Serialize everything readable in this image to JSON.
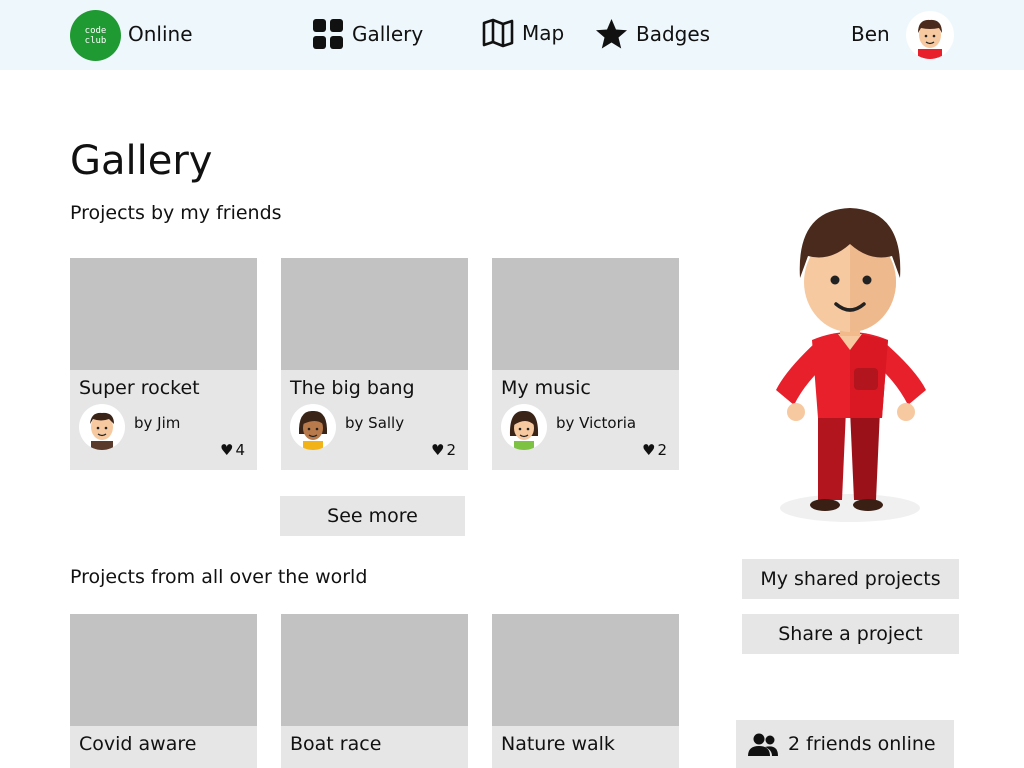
{
  "header": {
    "logo_line1": "code",
    "logo_line2": "club",
    "brand": "Online",
    "nav": [
      {
        "label": "Gallery",
        "icon": "grid-icon"
      },
      {
        "label": "Map",
        "icon": "map-icon"
      },
      {
        "label": "Badges",
        "icon": "star-icon"
      }
    ],
    "user_name": "Ben"
  },
  "page": {
    "title": "Gallery",
    "friends_section": "Projects by my friends",
    "world_section": "Projects from all over the world",
    "see_more": "See more"
  },
  "friend_projects": [
    {
      "title": "Super rocket",
      "author": "by Jim",
      "likes": "4"
    },
    {
      "title": "The big bang",
      "author": "by Sally",
      "likes": "2"
    },
    {
      "title": "My music",
      "author": "by Victoria",
      "likes": "2"
    }
  ],
  "world_projects": [
    {
      "title": "Covid aware"
    },
    {
      "title": "Boat race"
    },
    {
      "title": "Nature walk"
    }
  ],
  "sidebar": {
    "my_shared": "My shared projects",
    "share": "Share a project",
    "friends_online": "2 friends online"
  },
  "colors": {
    "topbar_bg": "#eef7fc",
    "logo_green": "#1f9a33",
    "card_bg": "#e6e6e6",
    "thumb_bg": "#c2c2c2",
    "shirt_red": "#e8202b",
    "pants_red": "#b3151f"
  }
}
